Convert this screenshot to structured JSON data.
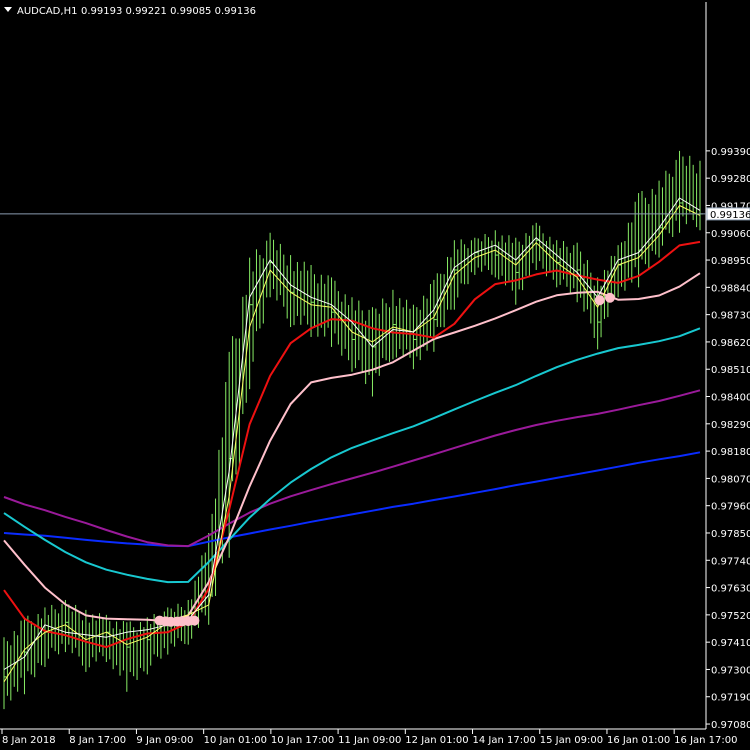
{
  "header": {
    "symbol": "AUDCAD,H1",
    "ohlc": "0.99193 0.99221 0.99085 0.99136"
  },
  "chart_data": {
    "type": "line",
    "title": "AUDCAD,H1",
    "background": "#000000",
    "grid": false,
    "ylim": [
      0.9706,
      0.9999
    ],
    "x_tick_labels": [
      "8 Jan 2018",
      "8 Jan 17:00",
      "9 Jan 09:00",
      "10 Jan 01:00",
      "10 Jan 17:00",
      "11 Jan 09:00",
      "12 Jan 01:00",
      "14 Jan 17:00",
      "15 Jan 09:00",
      "16 Jan 01:00",
      "16 Jan 17:00"
    ],
    "y_tick_labels": [
      "0.99390",
      "0.99280",
      "0.99170",
      "0.99060",
      "0.98950",
      "0.98840",
      "0.98730",
      "0.98620",
      "0.98510",
      "0.98400",
      "0.98290",
      "0.98180",
      "0.98070",
      "0.97960",
      "0.97850",
      "0.97740",
      "0.97630",
      "0.97520",
      "0.97410",
      "0.97300",
      "0.97190",
      "0.97080"
    ],
    "y_tick_values": [
      0.9939,
      0.9928,
      0.9917,
      0.9906,
      0.9895,
      0.9884,
      0.9873,
      0.9862,
      0.9851,
      0.984,
      0.9829,
      0.9818,
      0.9807,
      0.9796,
      0.9785,
      0.9774,
      0.9763,
      0.9752,
      0.9741,
      0.973,
      0.9719,
      0.9708
    ],
    "current_price": {
      "label": "0.99136",
      "value": 0.99136
    },
    "series": [
      {
        "color": "#0a2cff",
        "values": [
          0.9785,
          0.97844,
          0.97839,
          0.97831,
          0.97822,
          0.97815,
          0.97808,
          0.97803,
          0.97798,
          0.97797,
          0.97815,
          0.97832,
          0.97848,
          0.97864,
          0.97879,
          0.97895,
          0.9791,
          0.97925,
          0.9794,
          0.97955,
          0.97968,
          0.97983,
          0.97997,
          0.98012,
          0.98027,
          0.98043,
          0.98057,
          0.98072,
          0.98087,
          0.98102,
          0.98117,
          0.98133,
          0.98147,
          0.9816,
          0.98175
        ]
      },
      {
        "color": "#9a1a9a",
        "values": [
          0.97995,
          0.97965,
          0.97942,
          0.97915,
          0.9789,
          0.97862,
          0.97836,
          0.97813,
          0.978,
          0.97797,
          0.9784,
          0.97888,
          0.97932,
          0.97968,
          0.97998,
          0.98023,
          0.98047,
          0.9807,
          0.98093,
          0.98117,
          0.98142,
          0.98167,
          0.98193,
          0.98218,
          0.98243,
          0.98265,
          0.98285,
          0.98302,
          0.98317,
          0.9833,
          0.98347,
          0.98365,
          0.98382,
          0.98403,
          0.98425
        ]
      },
      {
        "color": "#18c8d0",
        "values": [
          0.9793,
          0.97875,
          0.97822,
          0.97773,
          0.97732,
          0.97702,
          0.97682,
          0.97665,
          0.97652,
          0.97653,
          0.97733,
          0.97823,
          0.97912,
          0.97987,
          0.98053,
          0.98108,
          0.98155,
          0.98193,
          0.98223,
          0.98252,
          0.9828,
          0.98313,
          0.98348,
          0.98382,
          0.98415,
          0.98446,
          0.98483,
          0.98518,
          0.98548,
          0.98573,
          0.98595,
          0.98608,
          0.98623,
          0.98643,
          0.98675
        ]
      },
      {
        "color": "#ffc0cb",
        "values": [
          0.9782,
          0.97722,
          0.9763,
          0.97562,
          0.97518,
          0.97505,
          0.97502,
          0.975,
          0.97495,
          0.97518,
          0.97652,
          0.97833,
          0.98038,
          0.98222,
          0.9837,
          0.98457,
          0.98475,
          0.98488,
          0.98508,
          0.98538,
          0.98585,
          0.98632,
          0.98658,
          0.98685,
          0.98715,
          0.98748,
          0.98782,
          0.98808,
          0.98818,
          0.98822,
          0.9879,
          0.98793,
          0.98807,
          0.98843,
          0.98897
        ]
      },
      {
        "color": "#ee1111",
        "values": [
          0.9762,
          0.97505,
          0.97455,
          0.97438,
          0.97412,
          0.9739,
          0.97422,
          0.97445,
          0.9745,
          0.97488,
          0.97625,
          0.97945,
          0.98288,
          0.98483,
          0.98615,
          0.98675,
          0.98712,
          0.98705,
          0.98675,
          0.98658,
          0.98652,
          0.98637,
          0.98693,
          0.98792,
          0.98853,
          0.98868,
          0.98892,
          0.98908,
          0.98888,
          0.98871,
          0.98858,
          0.98886,
          0.98943,
          0.99009,
          0.99023
        ]
      },
      {
        "color": "#ffff66",
        "values": [
          0.9725,
          0.9738,
          0.9745,
          0.9748,
          0.9742,
          0.9745,
          0.974,
          0.9743,
          0.9749,
          0.9752,
          0.9756,
          0.98,
          0.9868,
          0.9891,
          0.9882,
          0.9877,
          0.9876,
          0.9866,
          0.9862,
          0.9868,
          0.9866,
          0.9872,
          0.9889,
          0.9896,
          0.9899,
          0.9893,
          0.9902,
          0.9894,
          0.9888,
          0.9876,
          0.9893,
          0.9896,
          0.9905,
          0.9917,
          0.9913
        ]
      },
      {
        "color": "#ffffff",
        "values": [
          0.973,
          0.9735,
          0.9748,
          0.9745,
          0.9744,
          0.9743,
          0.9745,
          0.9746,
          0.9748,
          0.975,
          0.976,
          0.981,
          0.988,
          0.9895,
          0.9885,
          0.988,
          0.9877,
          0.987,
          0.986,
          0.9867,
          0.9866,
          0.9875,
          0.9892,
          0.9898,
          0.9901,
          0.9895,
          0.9904,
          0.9897,
          0.989,
          0.988,
          0.9895,
          0.9898,
          0.9908,
          0.992,
          0.9915
        ]
      }
    ],
    "price_bars": {
      "color": "#88ee66",
      "close": [
        0.9727,
        0.9737,
        0.9745,
        0.9749,
        0.9741,
        0.9745,
        0.9739,
        0.9742,
        0.9748,
        0.9753,
        0.976,
        0.9815,
        0.9877,
        0.9894,
        0.9882,
        0.9878,
        0.9874,
        0.9863,
        0.986,
        0.9869,
        0.9863,
        0.9871,
        0.9891,
        0.9898,
        0.9897,
        0.989,
        0.9903,
        0.9894,
        0.9891,
        0.987,
        0.9893,
        0.9899,
        0.9908,
        0.9918,
        0.99136
      ],
      "high": [
        0.9743,
        0.9751,
        0.9755,
        0.9758,
        0.9754,
        0.9752,
        0.9749,
        0.9751,
        0.9755,
        0.9758,
        0.9785,
        0.9858,
        0.9896,
        0.9906,
        0.9897,
        0.9893,
        0.9888,
        0.988,
        0.9876,
        0.9883,
        0.9877,
        0.9887,
        0.9903,
        0.9904,
        0.9907,
        0.9904,
        0.991,
        0.9903,
        0.9902,
        0.9888,
        0.9901,
        0.9922,
        0.9927,
        0.9939,
        0.9935
      ],
      "low": [
        0.9714,
        0.972,
        0.9731,
        0.9737,
        0.9729,
        0.9733,
        0.9721,
        0.9728,
        0.9736,
        0.974,
        0.9748,
        0.9775,
        0.9843,
        0.988,
        0.9868,
        0.9864,
        0.986,
        0.985,
        0.984,
        0.9855,
        0.9851,
        0.9858,
        0.9875,
        0.9889,
        0.9888,
        0.9877,
        0.9891,
        0.9884,
        0.9878,
        0.9859,
        0.988,
        0.9884,
        0.9896,
        0.9906,
        0.9907
      ]
    },
    "markers": {
      "color": "#ffc0cb",
      "points": [
        {
          "i": 7.6,
          "v": 0.97497
        },
        {
          "i": 7.9,
          "v": 0.97494
        },
        {
          "i": 8.15,
          "v": 0.97492
        },
        {
          "i": 8.45,
          "v": 0.97493
        },
        {
          "i": 8.7,
          "v": 0.97494
        },
        {
          "i": 9.0,
          "v": 0.97495
        },
        {
          "i": 9.3,
          "v": 0.97497
        },
        {
          "i": 29.1,
          "v": 0.98788
        },
        {
          "i": 29.6,
          "v": 0.98798
        }
      ]
    }
  }
}
